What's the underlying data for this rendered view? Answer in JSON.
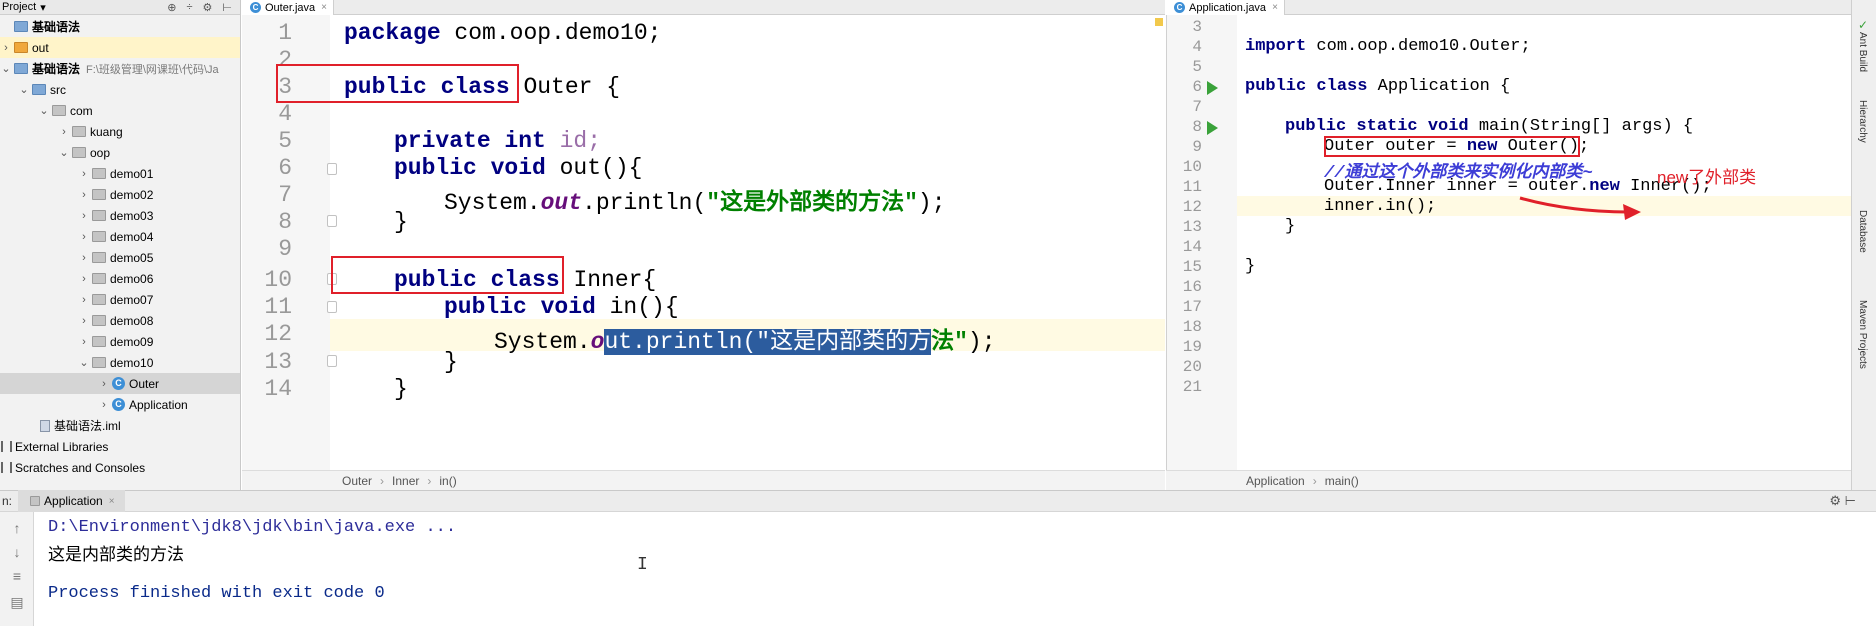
{
  "project": {
    "title": "Project",
    "items": [
      {
        "label": "基础语法",
        "note": ""
      },
      {
        "label": "out",
        "note": ""
      },
      {
        "label": "基础语法",
        "note": "F:\\班级管理\\网课班\\代码\\Ja"
      },
      {
        "label": "src",
        "note": ""
      },
      {
        "label": "com",
        "note": ""
      },
      {
        "label": "kuang",
        "note": ""
      },
      {
        "label": "oop",
        "note": ""
      },
      {
        "label": "demo01",
        "note": ""
      },
      {
        "label": "demo02",
        "note": ""
      },
      {
        "label": "demo03",
        "note": ""
      },
      {
        "label": "demo04",
        "note": ""
      },
      {
        "label": "demo05",
        "note": ""
      },
      {
        "label": "demo06",
        "note": ""
      },
      {
        "label": "demo07",
        "note": ""
      },
      {
        "label": "demo08",
        "note": ""
      },
      {
        "label": "demo09",
        "note": ""
      },
      {
        "label": "demo10",
        "note": ""
      },
      {
        "label": "Outer",
        "note": ""
      },
      {
        "label": "Application",
        "note": ""
      },
      {
        "label": "基础语法.iml",
        "note": ""
      },
      {
        "label": "External Libraries",
        "note": ""
      },
      {
        "label": "Scratches and Consoles",
        "note": ""
      }
    ]
  },
  "tabs": {
    "left": "Outer.java",
    "right": "Application.java"
  },
  "editor_left": {
    "line_numbers": [
      "1",
      "2",
      "3",
      "4",
      "5",
      "6",
      "7",
      "8",
      "9",
      "10",
      "11",
      "12",
      "13",
      "14"
    ],
    "l1_kw": "package",
    "l1_rest": " com.oop.demo10;",
    "l3_kw": "public class",
    "l3_name": " Outer",
    "l3_brace": " {",
    "l5_kw": "private int",
    "l5_rest": " id;",
    "l6_kw": "public void",
    "l6_rest": " out(){",
    "l7_a": "System.",
    "l7_fld": "out",
    "l7_b": ".println(",
    "l7_str": "\"这是外部类的方法\"",
    "l7_c": ");",
    "l8": "}",
    "l10_kw": "public class",
    "l10_name": " Inner",
    "l10_brace": "{",
    "l11_kw": "public void",
    "l11_rest": " in(){",
    "l12_a": "System.",
    "l12_fld1": "o",
    "l12_sel": "ut.println(\"这是内部类的方",
    "l12_str2": "法\"",
    "l12_c": ");",
    "l13": "}",
    "l14": "}"
  },
  "breadcrumb_left": [
    "Outer",
    "Inner",
    "in()"
  ],
  "editor_right": {
    "line_numbers": [
      "3",
      "4",
      "5",
      "6",
      "7",
      "8",
      "9",
      "10",
      "11",
      "12",
      "13",
      "14",
      "15",
      "16",
      "17",
      "18",
      "19",
      "20",
      "21"
    ],
    "r4_kw": "import",
    "r4_rest": " com.oop.demo10.Outer;",
    "r6_kw": "public class",
    "r6_rest": " Application {",
    "r8_kw": "public static void",
    "r8_rest": " main(String[] args) {",
    "r9_a": "Outer outer = ",
    "r9_kw": "new",
    "r9_b": " Outer();",
    "r10": "//通过这个外部类来实例化内部类~",
    "r11_a": "Outer.Inner inner = ",
    "r11_var": "outer",
    "r11_b": ".",
    "r11_kw": "new",
    "r11_c": " Inner();",
    "r12": "inner.in();",
    "r13": "}",
    "r15": "}"
  },
  "breadcrumb_right": [
    "Application",
    "main()"
  ],
  "annotation": "new了外部类",
  "toolstrip": {
    "items": [
      "Ant Build",
      "Hierarchy",
      "Database",
      "Maven Projects"
    ]
  },
  "run": {
    "prefix": "n:",
    "tab_label": "Application",
    "console": [
      "D:\\Environment\\jdk8\\jdk\\bin\\java.exe ...",
      "这是内部类的方法",
      "",
      "Process finished with exit code 0"
    ]
  },
  "colors": {
    "keyword": "#000080",
    "string": "#008000",
    "field": "#660e7a",
    "comment": "#3d3dd6",
    "annotation_red": "#e0202a",
    "selection": "#2c5c9e"
  }
}
